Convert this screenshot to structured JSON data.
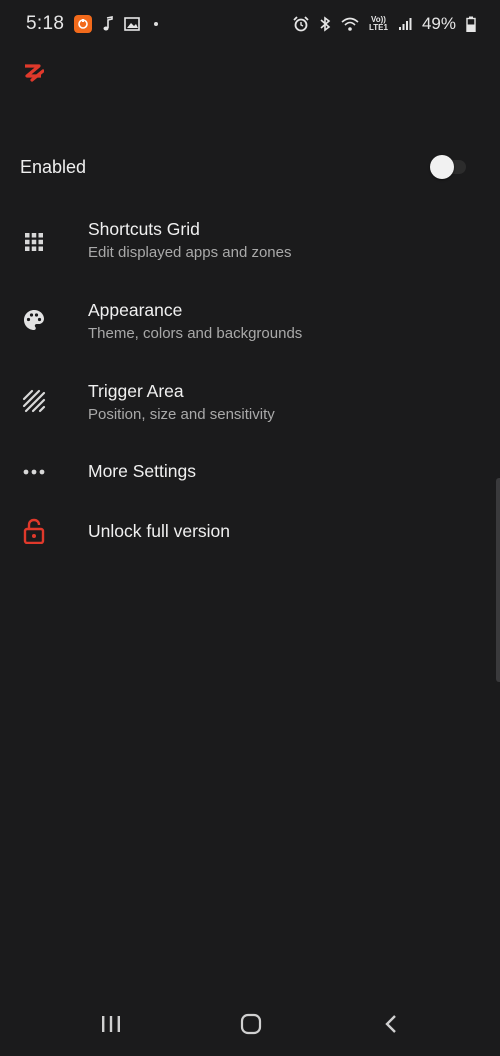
{
  "status_bar": {
    "time": "5:18",
    "battery": "49%",
    "lte_top": "Vo))",
    "lte_bottom": "LTE1",
    "icons": [
      "app-notification-icon",
      "music-note-icon",
      "image-icon",
      "dot-icon",
      "alarm-icon",
      "bluetooth-icon",
      "wifi-icon",
      "signal-icon",
      "battery-icon"
    ]
  },
  "app": {
    "logo": "app-logo-icon",
    "accent_color": "#e0392b"
  },
  "enabled": {
    "label": "Enabled",
    "toggle_on": false
  },
  "menu": [
    {
      "icon": "grid-icon",
      "title": "Shortcuts Grid",
      "subtitle": "Edit displayed apps and zones"
    },
    {
      "icon": "palette-icon",
      "title": "Appearance",
      "subtitle": "Theme, colors and backgrounds"
    },
    {
      "icon": "trigger-area-icon",
      "title": "Trigger Area",
      "subtitle": "Position, size and sensitivity"
    },
    {
      "icon": "more-dots-icon",
      "title": "More Settings"
    },
    {
      "icon": "lock-icon",
      "title": "Unlock full version"
    }
  ],
  "nav_bar": {
    "icons": [
      "recents-icon",
      "home-icon",
      "back-icon"
    ]
  }
}
